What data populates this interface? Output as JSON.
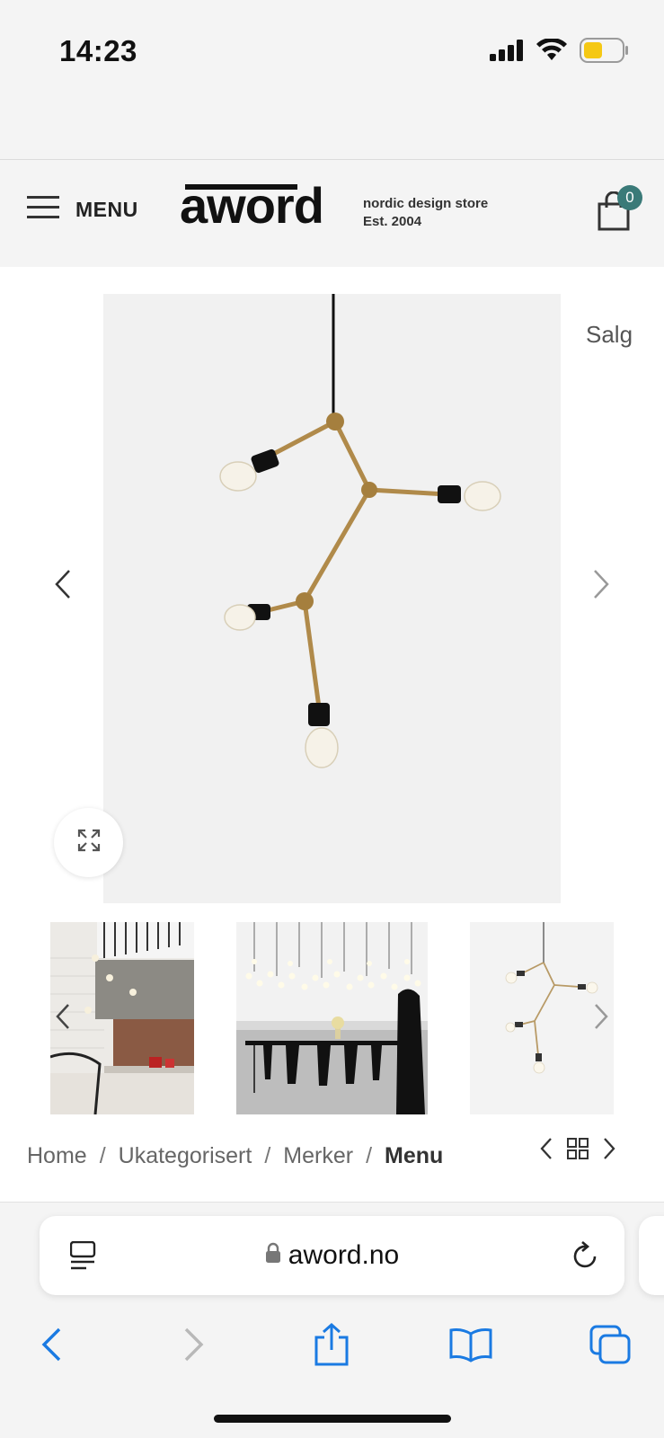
{
  "status_bar": {
    "time": "14:23"
  },
  "header": {
    "menu_label": "MENU",
    "logo": "aword",
    "tagline_line1": "nordic design store",
    "tagline_line2": "Est. 2004",
    "cart_count": "0"
  },
  "product": {
    "sale_label": "Salg"
  },
  "breadcrumb": {
    "items": [
      "Home",
      "Ukategorisert",
      "Merker"
    ],
    "current": "Menu"
  },
  "browser": {
    "url": "aword.no"
  },
  "colors": {
    "accent": "#3a7a78",
    "safari_blue": "#1a7ae2",
    "battery": "#f5c814"
  }
}
